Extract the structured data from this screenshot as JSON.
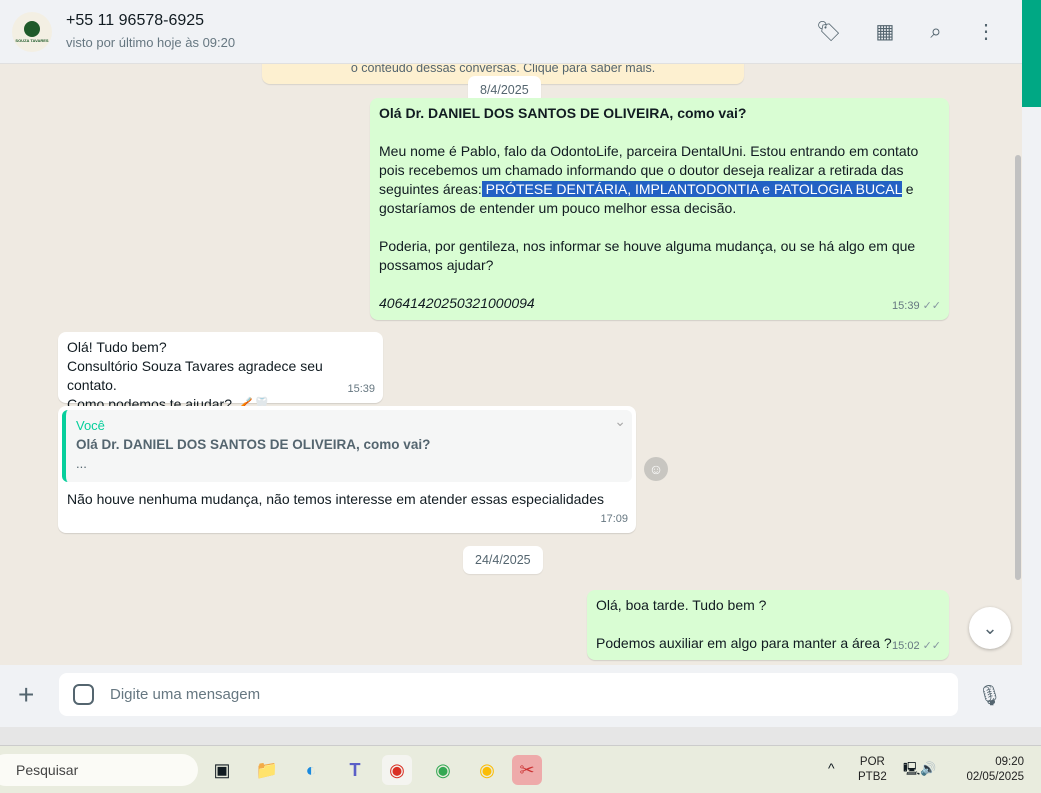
{
  "header": {
    "contact": "+55 11 96578-6925",
    "status": "visto por último hoje às 09:20",
    "avatar_text": "SOUZA TAVARES"
  },
  "notice": "o conteúdo dessas conversas. Clique para saber mais.",
  "dates": [
    "8/4/2025",
    "24/4/2025"
  ],
  "messages": {
    "m1": {
      "title": "Olá Dr. DANIEL DOS SANTOS DE OLIVEIRA, como vai?",
      "p1a": "Meu nome é Pablo, falo da OdontoLife, parceira DentalUni. Estou entrando em contato pois recebemos um chamado informando que o doutor deseja realizar a retirada das seguintes áreas:",
      "p1hl": " PRÓTESE DENTÁRIA, IMPLANTODONTIA e PATOLOGIA BUCAL",
      "p1b": " e gostaríamos de entender um pouco melhor essa decisão.",
      "p2": "Poderia, por gentileza, nos informar se houve alguma mudança, ou se há algo em que possamos ajudar?",
      "code": "40641420250321000094",
      "time": "15:39"
    },
    "m2": {
      "l1": "Olá! Tudo bem?",
      "l2": "Consultório Souza Tavares agradece seu contato.",
      "l3": "Como podemos te ajudar? 🪥🦷",
      "time": "15:39"
    },
    "m3": {
      "quote_author": "Você",
      "quote_title": "Olá Dr. DANIEL DOS SANTOS DE OLIVEIRA, como vai?",
      "quote_more": "...",
      "text": "Não houve nenhuma mudança, não temos interesse em atender essas especialidades",
      "time": "17:09"
    },
    "m4": {
      "l1": "Olá, boa tarde. Tudo bem ?",
      "l2": "Podemos auxiliar em algo para manter a área ?",
      "time": "15:02"
    }
  },
  "composer": {
    "placeholder": "Digite uma mensagem"
  },
  "taskbar": {
    "search": "Pesquisar",
    "lang1": "POR",
    "lang2": "PTB2",
    "time": "09:20",
    "date": "02/05/2025"
  },
  "colors": {
    "accent": "#00a884",
    "outgoing": "#d9fdd3",
    "highlight": "#2361c4"
  }
}
